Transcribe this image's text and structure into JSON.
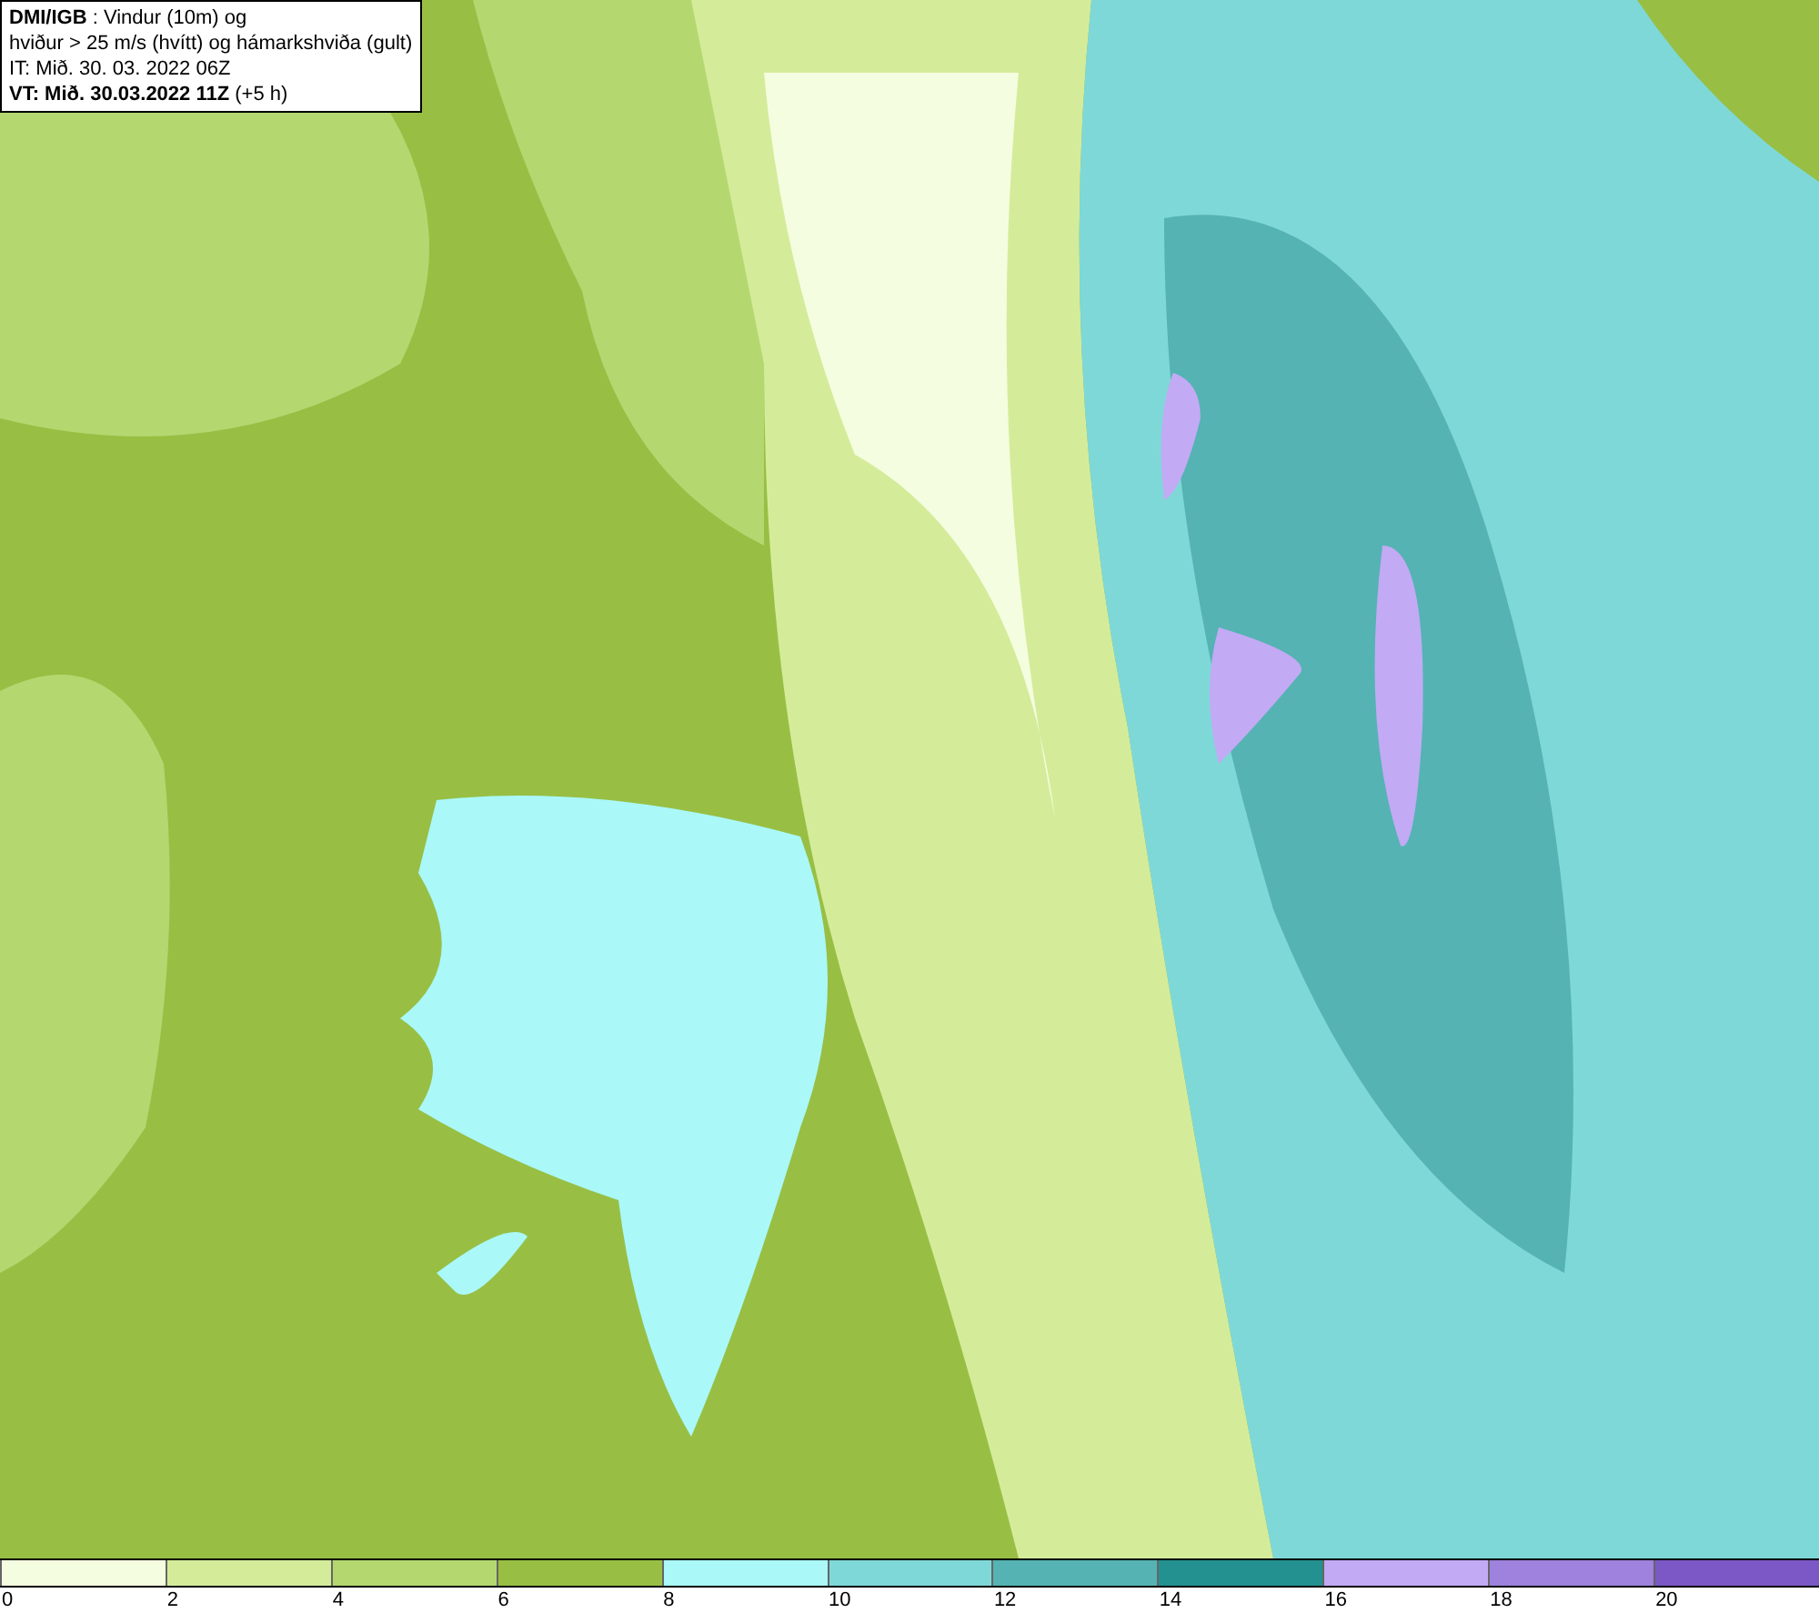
{
  "info_box": {
    "lines": [
      "**DMI/IGB** : Vindur (10m) og",
      "hviður > 25 m/s (hvítt) og hámarkshviða (gult)",
      "IT: Mið. 30. 03. 2022 06Z",
      "**VT: Mið. 30.03.2022 11Z** (+5 h)"
    ]
  },
  "color_scale": {
    "segments": [
      {
        "color": "#f5fde0",
        "label": "0"
      },
      {
        "color": "#d4ec9a",
        "label": "2"
      },
      {
        "color": "#b5d770",
        "label": "4"
      },
      {
        "color": "#98bf44",
        "label": "6"
      },
      {
        "color": "#aaf8f8",
        "label": "8"
      },
      {
        "color": "#7fd8d8",
        "label": "10"
      },
      {
        "color": "#55b3b3",
        "label": "12"
      },
      {
        "color": "#249191",
        "label": "14"
      },
      {
        "color": "#c2aaf5",
        "label": "16"
      },
      {
        "color": "#9e82dd",
        "label": "18"
      },
      {
        "color": "#7b58c6",
        "label": "20"
      }
    ]
  }
}
